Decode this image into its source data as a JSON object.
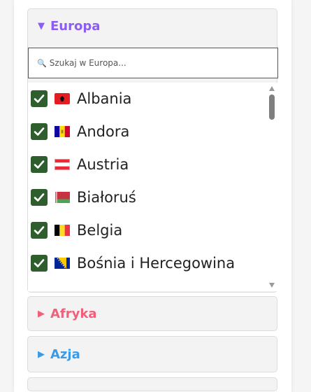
{
  "sections": {
    "europe": {
      "label": "Europa",
      "color": "#8b5cf6",
      "expanded": true
    },
    "africa": {
      "label": "Afryka",
      "color": "#f0607a",
      "expanded": false
    },
    "asia": {
      "label": "Azja",
      "color": "#3b9ae6",
      "expanded": false
    }
  },
  "search": {
    "icon": "🔍",
    "placeholder": "Szukaj w Europa..."
  },
  "countries": [
    {
      "name": "Albania",
      "checked": true,
      "flag": "albania"
    },
    {
      "name": "Andora",
      "checked": true,
      "flag": "andorra"
    },
    {
      "name": "Austria",
      "checked": true,
      "flag": "austria"
    },
    {
      "name": "Białoruś",
      "checked": true,
      "flag": "belarus"
    },
    {
      "name": "Belgia",
      "checked": true,
      "flag": "belgium"
    },
    {
      "name": "Bośnia i Hercegowina",
      "checked": true,
      "flag": "bosnia-and-herzegovina"
    }
  ]
}
